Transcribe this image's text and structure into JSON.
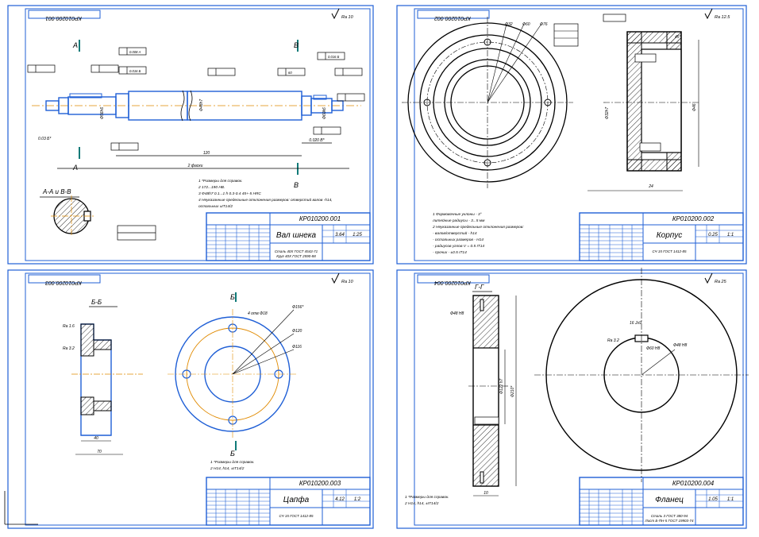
{
  "colors": {
    "frame": "#1f5fd6",
    "part": "#000000",
    "center": "#e08a00",
    "edit": "#1f66e0",
    "background": "#ffffff"
  },
  "sheets": [
    {
      "id": "shaft",
      "top_code": "КР010200.001",
      "title_code": "КР010200.001",
      "name": "Вал шнека",
      "roughness": "Ra 10",
      "scale": "1:25",
      "mass": "3.64",
      "material_1": "Сталь 40Х ГОСТ 4543-71",
      "material_2": "Круг 40Х ГОСТ 2590-88",
      "section_title": "А-А и В-В",
      "cut_a": "А",
      "cut_b": "В",
      "notes": [
        "1 *Размеры для справок.",
        "2 172...190 НВ.",
        "3 Ф48h7 0.1...1 h 0.3-0.4 45+-5 HRC",
        "4 Неуказанные предельные отклонения размеров: отверстий валов -h14,",
        "  остальных ±IT14/2"
      ],
      "dims": [
        "Ф48h7",
        "Ф56h6",
        "Ф60k6",
        "1830*",
        "2130*",
        "120",
        "2 фаски",
        "60",
        "20",
        "0.020 B*",
        "0.03 Б*",
        "0.008 А",
        "0.016 Б"
      ]
    },
    {
      "id": "housing",
      "top_code": "КР010200.002",
      "title_code": "КР010200.002",
      "name": "Корпус",
      "roughness": "Ra 12.5",
      "scale": "1:1",
      "mass": "0.25",
      "material_1": "СЧ 15 ГОСТ 1412-85",
      "notes": [
        "1 Формовочные уклоны - 3°",
        "  литейные радиусы - 3...5 мм",
        "2 Неуказанные предельные отклонения размеров:",
        "  - валов/отверстий - h14",
        "  - остальных размеров - H14",
        "  - радиусов углов V = 0.5 IT14",
        "  - прочих - ±0.5 IT14"
      ],
      "dims": [
        "Ф32",
        "Ф60",
        "Ф76",
        "Ф98",
        "Ф32h7",
        "Ф46",
        "Ф72",
        "Ф56",
        "45°",
        "0.5",
        "24",
        "Ra 3.2",
        "4 отв Ф6"
      ]
    },
    {
      "id": "trunnion",
      "top_code": "КР010200.003",
      "title_code": "КР010200.003",
      "name": "Цапфа",
      "roughness": "Ra 10",
      "scale": "1:2",
      "mass": "4.12",
      "material_1": "СЧ 15 ГОСТ 1412-85",
      "section_title": "Б-Б",
      "cut": "Б",
      "notes": [
        "1 *Размеры для справок.",
        "2 H14, h14, ±IT14/2"
      ],
      "dims": [
        "Ф156*",
        "Ф120",
        "Ф116",
        "4 отв Ф18",
        "40",
        "70",
        "Ra 1.6",
        "Ra 3.2",
        "5 отв"
      ]
    },
    {
      "id": "flange",
      "top_code": "КР010200.004",
      "title_code": "КР010200.004",
      "name": "Фланец",
      "roughness": "Ra 25",
      "scale": "1:1",
      "mass": "1.05",
      "material_1": "Сталь 3 ГОСТ 380-94",
      "material_2": "Лист Б-ПН-5 ГОСТ 19903-74",
      "section_title": "Г-Г",
      "cut": "Г",
      "notes": [
        "1 *Размеры для справок.",
        "2 H14, h14, ±IT14/2"
      ],
      "dims": [
        "Ф48 Н8",
        "Ф210*",
        "Ф122 h7",
        "Ra 3.2",
        "Ra 1.6",
        "Ф60 H8",
        "16 Js9",
        "10"
      ]
    }
  ]
}
